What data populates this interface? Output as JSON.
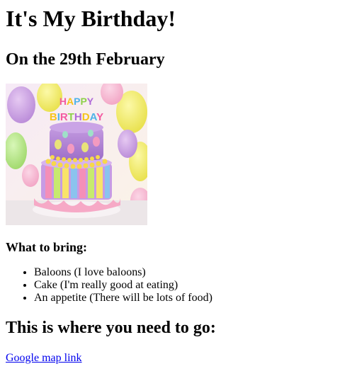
{
  "page": {
    "title": "It's My Birthday!",
    "subtitle": "On the 29th February",
    "cake_image": {
      "alt_semantic": "birthday-cake",
      "banner_line1": "HAPPY",
      "banner_line2": "BIRTHDAY"
    },
    "bring_heading": "What to bring:",
    "bring_items": [
      "Baloons (I love baloons)",
      "Cake (I'm really good at eating)",
      "An appetite (There will be lots of food)"
    ],
    "where_heading": "This is where you need to go:",
    "map_link_text": "Google map link"
  },
  "colors": {
    "link": "#0000ee",
    "text": "#000000",
    "background": "#ffffff"
  }
}
